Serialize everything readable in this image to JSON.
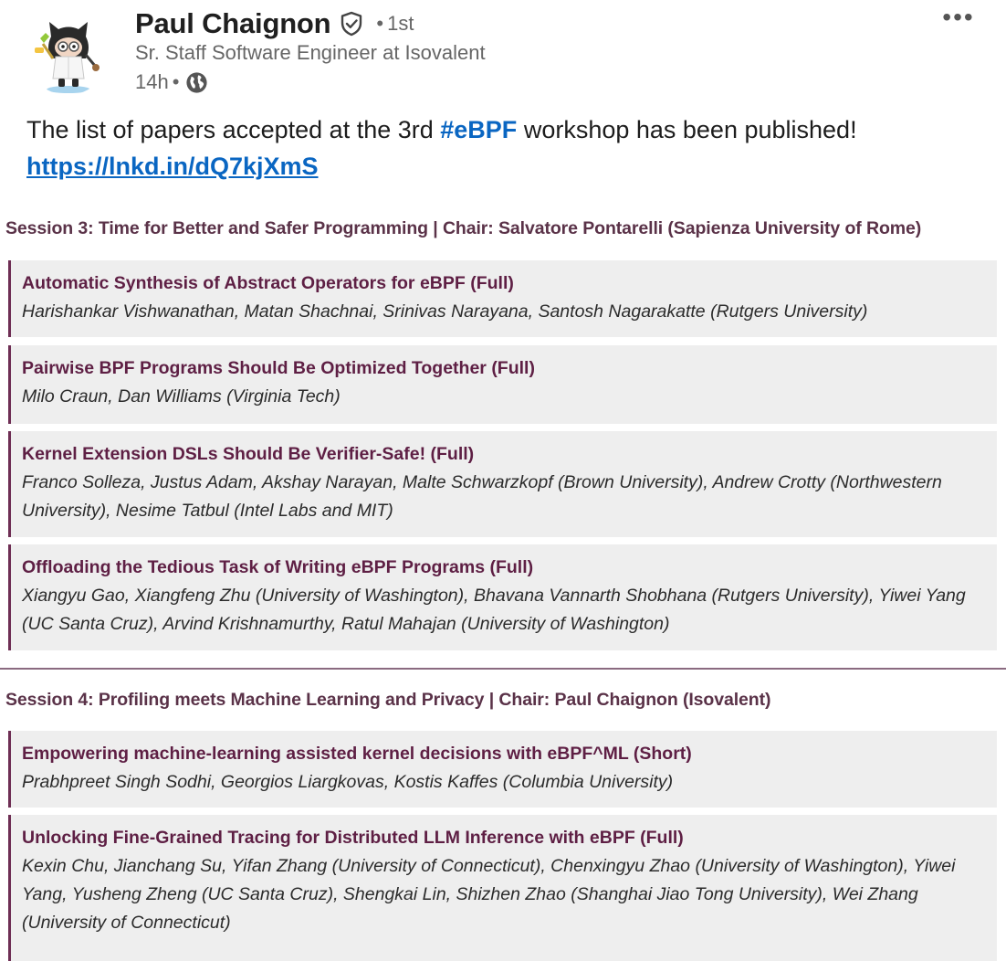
{
  "post": {
    "author": "Paul Chaignon",
    "degree_dot": "•",
    "degree": "1st",
    "headline": "Sr. Staff Software Engineer at Isovalent",
    "time": "14h",
    "time_dot": "•",
    "visibility_icon": "globe-icon",
    "more_label": "•••",
    "text_before": "The list of papers accepted at the 3rd ",
    "hashtag": "#eBPF",
    "text_middle": " workshop has been published! ",
    "link": "https://lnkd.in/dQ7kjXmS"
  },
  "program": {
    "sessions": [
      {
        "title": "Session 3: Time for Better and Safer Programming | Chair: Salvatore Pontarelli (Sapienza University of Rome)",
        "papers": [
          {
            "title": "Automatic Synthesis of Abstract Operators for eBPF (Full)",
            "authors": "Harishankar Vishwanathan, Matan Shachnai, Srinivas Narayana, Santosh Nagarakatte (Rutgers University)"
          },
          {
            "title": "Pairwise BPF Programs Should Be Optimized Together (Full)",
            "authors": "Milo Craun, Dan Williams (Virginia Tech)"
          },
          {
            "title": "Kernel Extension DSLs Should Be Verifier-Safe! (Full)",
            "authors": "Franco Solleza, Justus Adam, Akshay Narayan, Malte Schwarzkopf (Brown University), Andrew Crotty (Northwestern University), Nesime Tatbul (Intel Labs and MIT)"
          },
          {
            "title": "Offloading the Tedious Task of Writing eBPF Programs (Full)",
            "authors": "Xiangyu Gao, Xiangfeng Zhu (University of Washington), Bhavana Vannarth Shobhana (Rutgers University), Yiwei Yang (UC Santa Cruz), Arvind Krishnamurthy, Ratul Mahajan (University of Washington)"
          }
        ]
      },
      {
        "title": "Session 4: Profiling meets Machine Learning and Privacy | Chair: Paul Chaignon (Isovalent)",
        "papers": [
          {
            "title": "Empowering machine-learning assisted kernel decisions with eBPF^ML (Short)",
            "authors": "Prabhpreet Singh Sodhi, Georgios Liargkovas, Kostis Kaffes (Columbia University)"
          },
          {
            "title": "Unlocking Fine-Grained Tracing for Distributed LLM Inference with eBPF (Full)",
            "authors": "Kexin Chu, Jianchang Su, Yifan Zhang (University of Connecticut), Chenxingyu Zhao (University of Washington), Yiwei Yang, Yusheng Zheng (UC Santa Cruz), Shengkai Lin, Shizhen Zhao (Shanghai Jiao Tong University), Wei Zhang (University of Connecticut)"
          }
        ]
      }
    ]
  },
  "colors": {
    "link": "#0a66c2",
    "paper_title": "#5e1f44",
    "session_title": "#5a3248",
    "paper_border": "#6e2e54",
    "paper_bg": "#eeeeee"
  }
}
